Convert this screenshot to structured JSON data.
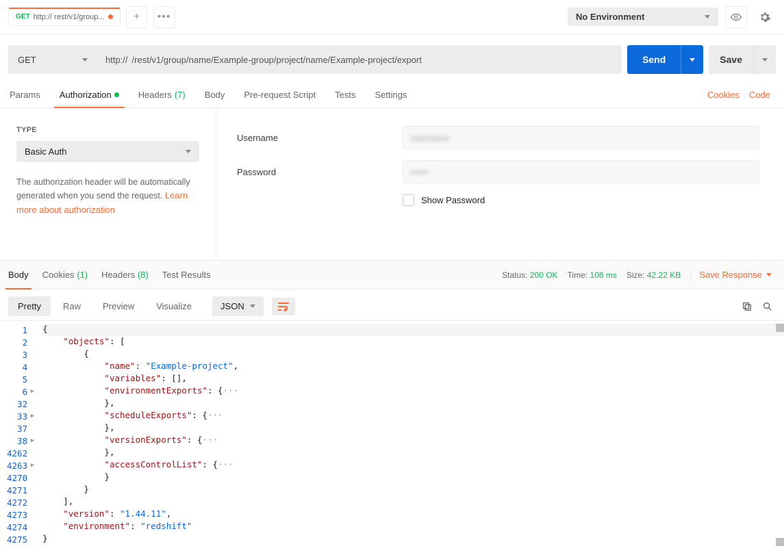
{
  "tab": {
    "method": "GET",
    "title_prefix": "http://",
    "title_blur": "          ",
    "title_suffix": "rest/v1/group..."
  },
  "env": {
    "label": "No Environment"
  },
  "request": {
    "method": "GET",
    "url_prefix": "http://",
    "url_blur": "            ",
    "url_suffix": "/rest/v1/group/name/Example-group/project/name/Example-project/export",
    "send": "Send",
    "save": "Save"
  },
  "req_tabs": {
    "params": "Params",
    "authorization": "Authorization",
    "headers": "Headers",
    "headers_count": "(7)",
    "body": "Body",
    "prerequest": "Pre-request Script",
    "tests": "Tests",
    "settings": "Settings",
    "cookies": "Cookies",
    "code": "Code"
  },
  "auth": {
    "type_label": "TYPE",
    "auth_type": "Basic Auth",
    "help_text": "The authorization header will be automatically generated when you send the request. ",
    "learn_more": "Learn more about authorization",
    "username_label": "Username",
    "password_label": "Password",
    "show_password": "Show Password"
  },
  "resp_tabs": {
    "body": "Body",
    "cookies": "Cookies",
    "cookies_count": "(1)",
    "headers": "Headers",
    "headers_count": "(8)",
    "test_results": "Test Results"
  },
  "resp_meta": {
    "status_label": "Status:",
    "status_value": "200 OK",
    "time_label": "Time:",
    "time_value": "108 ms",
    "size_label": "Size:",
    "size_value": "42.22 KB",
    "save_response": "Save Response"
  },
  "fmt": {
    "pretty": "Pretty",
    "raw": "Raw",
    "preview": "Preview",
    "visualize": "Visualize",
    "json": "JSON"
  },
  "code_lines": [
    {
      "num": "1",
      "fold": "",
      "content": [
        [
          "p",
          "{"
        ]
      ],
      "hl": true
    },
    {
      "num": "2",
      "fold": "",
      "content": [
        [
          "p",
          "    "
        ],
        [
          "k",
          "\"objects\""
        ],
        [
          "p",
          ": ["
        ]
      ]
    },
    {
      "num": "3",
      "fold": "",
      "content": [
        [
          "p",
          "        {"
        ]
      ]
    },
    {
      "num": "4",
      "fold": "",
      "content": [
        [
          "p",
          "            "
        ],
        [
          "k",
          "\"name\""
        ],
        [
          "p",
          ": "
        ],
        [
          "s",
          "\"Example-project\""
        ],
        [
          "p",
          ","
        ]
      ]
    },
    {
      "num": "5",
      "fold": "",
      "content": [
        [
          "p",
          "            "
        ],
        [
          "k",
          "\"variables\""
        ],
        [
          "p",
          ": [],"
        ]
      ]
    },
    {
      "num": "6",
      "fold": ">",
      "content": [
        [
          "p",
          "            "
        ],
        [
          "k",
          "\"environmentExports\""
        ],
        [
          "p",
          ": {"
        ],
        [
          "d",
          "···"
        ]
      ]
    },
    {
      "num": "32",
      "fold": "",
      "content": [
        [
          "p",
          "            },"
        ]
      ]
    },
    {
      "num": "33",
      "fold": ">",
      "content": [
        [
          "p",
          "            "
        ],
        [
          "k",
          "\"scheduleExports\""
        ],
        [
          "p",
          ": {"
        ],
        [
          "d",
          "···"
        ]
      ]
    },
    {
      "num": "37",
      "fold": "",
      "content": [
        [
          "p",
          "            },"
        ]
      ]
    },
    {
      "num": "38",
      "fold": ">",
      "content": [
        [
          "p",
          "            "
        ],
        [
          "k",
          "\"versionExports\""
        ],
        [
          "p",
          ": {"
        ],
        [
          "d",
          "···"
        ]
      ]
    },
    {
      "num": "4262",
      "fold": "",
      "content": [
        [
          "p",
          "            },"
        ]
      ]
    },
    {
      "num": "4263",
      "fold": ">",
      "content": [
        [
          "p",
          "            "
        ],
        [
          "k",
          "\"accessControlList\""
        ],
        [
          "p",
          ": {"
        ],
        [
          "d",
          "···"
        ]
      ]
    },
    {
      "num": "4270",
      "fold": "",
      "content": [
        [
          "p",
          "            }"
        ]
      ]
    },
    {
      "num": "4271",
      "fold": "",
      "content": [
        [
          "p",
          "        }"
        ]
      ]
    },
    {
      "num": "4272",
      "fold": "",
      "content": [
        [
          "p",
          "    ],"
        ]
      ]
    },
    {
      "num": "4273",
      "fold": "",
      "content": [
        [
          "p",
          "    "
        ],
        [
          "k",
          "\"version\""
        ],
        [
          "p",
          ": "
        ],
        [
          "s",
          "\"1.44.11\""
        ],
        [
          "p",
          ","
        ]
      ]
    },
    {
      "num": "4274",
      "fold": "",
      "content": [
        [
          "p",
          "    "
        ],
        [
          "k",
          "\"environment\""
        ],
        [
          "p",
          ": "
        ],
        [
          "s",
          "\"redshift\""
        ]
      ]
    },
    {
      "num": "4275",
      "fold": "",
      "content": [
        [
          "p",
          "}"
        ]
      ]
    }
  ]
}
